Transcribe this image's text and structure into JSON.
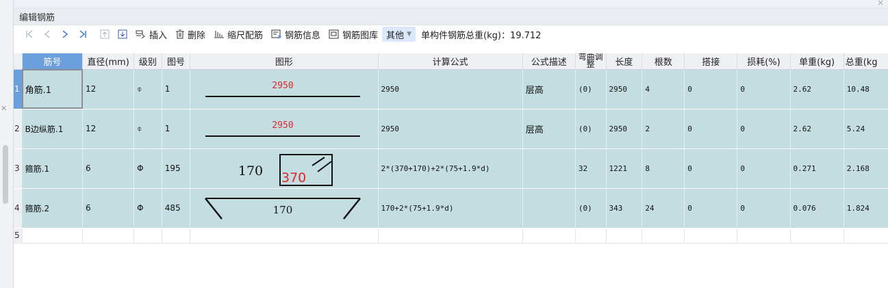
{
  "window": {
    "title": "编辑钢筋"
  },
  "toolbar": {
    "insert_label": "插入",
    "delete_label": "删除",
    "scale_label": "缩尺配筋",
    "info_label": "钢筋信息",
    "library_label": "钢筋图库",
    "other_label": "其他",
    "total_weight": "单构件钢筋总重(kg)：19.712"
  },
  "columns": [
    "筋号",
    "直径(mm)",
    "级别",
    "图号",
    "图形",
    "计算公式",
    "公式描述",
    "弯曲调整",
    "长度",
    "根数",
    "搭接",
    "损耗(%)",
    "单重(kg)",
    "总重(kg"
  ],
  "rows": [
    {
      "num": "1",
      "name": "角筋.1",
      "dia": "12",
      "grade": "⌽",
      "fig_no": "1",
      "fig_label": "2950",
      "formula": "2950",
      "desc": "层高",
      "bend": "(0)",
      "length": "2950",
      "count": "4",
      "lap": "0",
      "loss": "0",
      "unit_w": "2.62",
      "total_w": "10.48"
    },
    {
      "num": "2",
      "name": "B边纵筋.1",
      "dia": "12",
      "grade": "⌽",
      "fig_no": "1",
      "fig_label": "2950",
      "formula": "2950",
      "desc": "层高",
      "bend": "(0)",
      "length": "2950",
      "count": "2",
      "lap": "0",
      "loss": "0",
      "unit_w": "2.62",
      "total_w": "5.24"
    },
    {
      "num": "3",
      "name": "箍筋.1",
      "dia": "6",
      "grade": "Φ",
      "fig_no": "195",
      "fig_label_a": "170",
      "fig_label_b": "370",
      "formula": "2*(370+170)+2*(75+1.9*d)",
      "desc": "",
      "bend": "32",
      "length": "1221",
      "count": "8",
      "lap": "0",
      "loss": "0",
      "unit_w": "0.271",
      "total_w": "2.168"
    },
    {
      "num": "4",
      "name": "箍筋.2",
      "dia": "6",
      "grade": "Φ",
      "fig_no": "485",
      "fig_label": "170",
      "formula": "170+2*(75+1.9*d)",
      "desc": "",
      "bend": "(0)",
      "length": "343",
      "count": "24",
      "lap": "0",
      "loss": "0",
      "unit_w": "0.076",
      "total_w": "1.824"
    }
  ],
  "empty_row_num": "5",
  "icons": [
    "first-icon",
    "prev-icon",
    "next-icon",
    "last-icon",
    "move-up-icon",
    "move-down-icon",
    "insert-icon",
    "delete-icon",
    "scale-icon",
    "info-icon",
    "library-icon",
    "dropdown-caret-icon",
    "close-icon"
  ],
  "colors": {
    "row_bg": "#c3dde0",
    "header_selected": "#6c9fde",
    "dimension_red": "#e0262b"
  }
}
